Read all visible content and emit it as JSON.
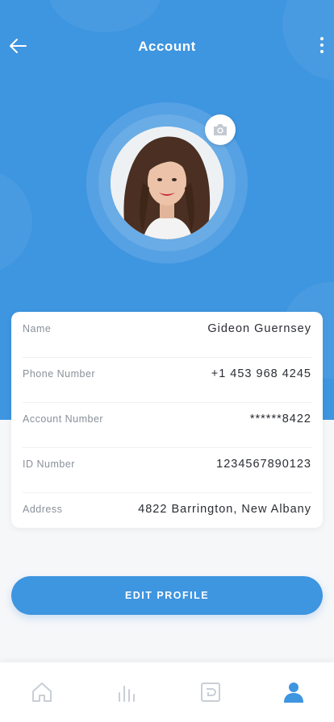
{
  "header": {
    "title": "Account"
  },
  "profile": {
    "fields": [
      {
        "label": "Name",
        "value": "Gideon Guernsey"
      },
      {
        "label": "Phone Number",
        "value": "+1 453 968 4245"
      },
      {
        "label": "Account Number",
        "value": "******8422"
      },
      {
        "label": "ID Number",
        "value": "1234567890123"
      },
      {
        "label": "Address",
        "value": "4822 Barrington, New Albany"
      }
    ]
  },
  "actions": {
    "edit_label": "EDIT PROFILE"
  },
  "tabbar": {
    "items": [
      "home-icon",
      "chart-icon",
      "card-icon",
      "profile-icon"
    ],
    "active_index": 3
  },
  "colors": {
    "primary": "#3e95e0",
    "inactive_icon": "#c9ced6",
    "background": "#f6f7f9"
  },
  "icons": {
    "back": "arrow-left-icon",
    "more": "more-vertical-icon",
    "camera": "camera-icon"
  }
}
